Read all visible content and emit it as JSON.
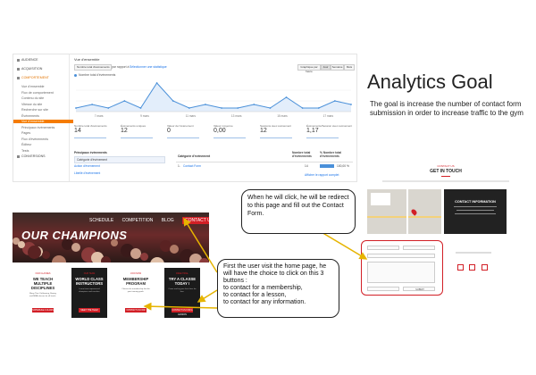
{
  "analytics": {
    "header": "Vue d'ensemble",
    "toolbar": {
      "dropdown": "Nombre total d'événements",
      "vs": "par rapport à",
      "select": "Sélectionner une statistique",
      "btn1": "Graphique par heure",
      "btn2": "Jour",
      "btn3": "Semaine",
      "btn4": "Mois"
    },
    "legend": "Nombre total d'événements",
    "sidebar": [
      {
        "label": "AUDIENCE",
        "kind": "top"
      },
      {
        "label": "ACQUISITION",
        "kind": "top"
      },
      {
        "label": "COMPORTEMENT",
        "kind": "top-hl"
      },
      {
        "label": "Vue d'ensemble",
        "kind": "sub"
      },
      {
        "label": "Flux de comportement",
        "kind": "sub"
      },
      {
        "label": "Contenu du site",
        "kind": "sub"
      },
      {
        "label": "Vitesse du site",
        "kind": "sub"
      },
      {
        "label": "Recherche sur site",
        "kind": "sub"
      },
      {
        "label": "Événements",
        "kind": "sub"
      },
      {
        "label": "Vue d'ensemble",
        "kind": "active"
      },
      {
        "label": "Principaux événements",
        "kind": "sub"
      },
      {
        "label": "Pages",
        "kind": "sub"
      },
      {
        "label": "Flux d'événements",
        "kind": "sub"
      },
      {
        "label": "Éditeur",
        "kind": "sub"
      },
      {
        "label": "Tests",
        "kind": "sub"
      },
      {
        "label": "CONVERSIONS",
        "kind": "top"
      }
    ],
    "chart_data": {
      "type": "line",
      "title": "",
      "xlabel": "",
      "ylabel": "",
      "x_ticks": [
        "7 mars",
        "9 mars",
        "11 mars",
        "13 mars",
        "15 mars",
        "17 mars"
      ],
      "series": [
        {
          "name": "Nombre total d'événements",
          "values": [
            1,
            2,
            1,
            3,
            1,
            8,
            3,
            1,
            2,
            1,
            1,
            2,
            1,
            4,
            1,
            1,
            3,
            2
          ]
        }
      ],
      "ylim": [
        0,
        9
      ],
      "color": "#4a90d9"
    },
    "metrics": [
      {
        "label": "Nombre total d'événements",
        "value": "14"
      },
      {
        "label": "Événements uniques",
        "value": "12"
      },
      {
        "label": "Valeur de l'événement",
        "value": "0"
      },
      {
        "label": "Valeur moyenne",
        "value": "0,00"
      },
      {
        "label": "Sessions avec événement",
        "value": "12"
      },
      {
        "label": "Événements/Session avec événement",
        "value": "1,17"
      }
    ],
    "table": {
      "left_title": "Principaux événements",
      "left_rows": [
        "Catégorie d'événement",
        "Action d'événement",
        "Libellé d'événement"
      ],
      "right_header": "Catégorie d'événement",
      "col1": "Nombre total d'événements",
      "col2": "% Nombre total d'événements",
      "row_name": "Contact Form",
      "row_value": "14",
      "row_pct": "100,00 %",
      "footer_link": "Afficher le rapport complet"
    }
  },
  "title": "Analytics Goal",
  "goal_text": "The goal is increase the number of contact form submission in order to increase traffic to the gym",
  "website": {
    "nav": [
      "SCHEDULE",
      "COMPETITION",
      "BLOG"
    ],
    "nav_contact": "CONTACT US",
    "hero": "OUR CHAMPIONS",
    "cards": [
      {
        "tag": "OUR CLASSES",
        "title": "WE TEACH MULTIPLE DISCIPLINES",
        "desc": "Muay Thai, Kickboxing, Boxing and MMA classes for all levels.",
        "button": "SCHEDULE A CLASS",
        "style": "white"
      },
      {
        "tag": "OUR TEAM",
        "title": "WORLD CLASS INSTRUCTORS",
        "desc": "Learn from experienced champions and coaches.",
        "button": "MEET THE TEAM",
        "style": "dark"
      },
      {
        "tag": "JOIN NOW",
        "title": "MEMBERSHIP PROGRAM",
        "desc": "Choose the membership that fits your training goals.",
        "button": "CONTACT US FOR MEMBERSHIP",
        "style": "white"
      },
      {
        "tag": "FREE TRIAL",
        "title": "TRY A CLASSE TODAY !",
        "desc": "Come and try your first class for free.",
        "button": "CONTACT US FOR A LESSON",
        "style": "dark"
      }
    ]
  },
  "callout_top": "When he will click, he will be redirect to this page and fill out the Contact Form.",
  "callout_bottom": "First the user visit the home page, he will have the choice to click on this 3 buttons :\nto contact for a membership,\nto contact for a lesson,\nto contact for any information.",
  "contact_page": {
    "kicker": "CONTACT US",
    "title": "GET IN TOUCH",
    "info_title": "CONTACT INFORMATION",
    "send": "SUBMIT",
    "accent": "#d21f26"
  }
}
